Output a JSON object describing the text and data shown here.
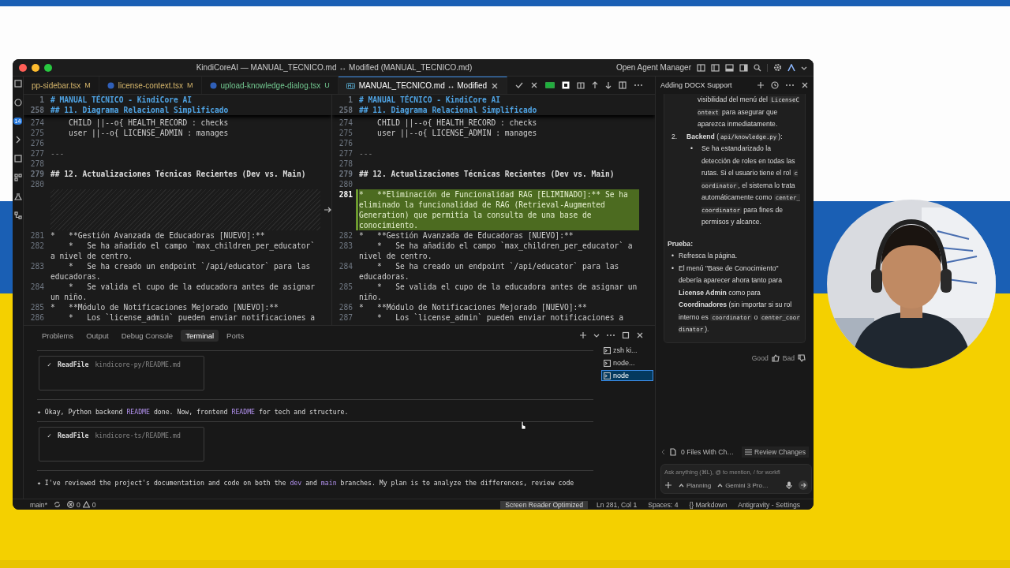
{
  "window": {
    "title": "KindiCoreAI — MANUAL_TECNICO.md ↔ Modified (MANUAL_TECNICO.md)",
    "agent_manager": "Open Agent Manager"
  },
  "activity_bar": {
    "badge": "14"
  },
  "tabs": [
    {
      "label": "pp-sidebar.tsx",
      "status": "M",
      "kind": "modified",
      "selected": false
    },
    {
      "label": "license-context.tsx",
      "status": "M",
      "kind": "modified",
      "selected": false
    },
    {
      "label": "upload-knowledge-dialog.tsx",
      "status": "U",
      "kind": "untracked",
      "selected": false
    },
    {
      "label": "MANUAL_TECNICO.md ↔ Modified",
      "kind": "diff",
      "selected": true
    }
  ],
  "editor": {
    "panes": [
      {
        "sticky": [
          {
            "number": "1",
            "text": "# MANUAL TÉCNICO - KindiCore AI",
            "kind": "title"
          },
          {
            "number": "258",
            "text": "## 11. Diagrama Relacional Simplificado",
            "kind": "title"
          }
        ],
        "lines": [
          {
            "number": "274",
            "text": "    CHILD ||--o{ HEALTH_RECORD : checks",
            "kind": "code"
          },
          {
            "number": "275",
            "text": "    user ||--o{ LICENSE_ADMIN : manages",
            "kind": "code"
          },
          {
            "number": "276",
            "kind": "code"
          },
          {
            "number": "277",
            "text": "---",
            "kind": "rule"
          },
          {
            "number": "278",
            "kind": "code"
          },
          {
            "number": "279",
            "text": "## 12. Actualizaciones Técnicas Recientes (Dev vs. Main)",
            "kind": "heading"
          },
          {
            "number": "280",
            "kind": "code"
          },
          {
            "kind": "gap"
          },
          {
            "number": "281",
            "text": "*   **Gestión Avanzada de Educadoras [NUEVO]:**",
            "kind": "code"
          },
          {
            "number": "282",
            "text": "    *   Se ha añadido el campo `max_children_per_educator` a nivel de centro.",
            "kind": "code"
          },
          {
            "number": "283",
            "text": "    *   Se ha creado un endpoint `/api/educator` para las educadoras.",
            "kind": "code"
          },
          {
            "number": "284",
            "text": "    *   Se valida el cupo de la educadora antes de asignar un niño.",
            "kind": "code"
          },
          {
            "number": "285",
            "text": "*   **Módulo de Notificaciones Mejorado [NUEVO]:**",
            "kind": "code"
          },
          {
            "number": "286",
            "text": "    *   Los `license_admin` pueden enviar notificaciones a",
            "kind": "code"
          }
        ]
      },
      {
        "sticky": [
          {
            "number": "1",
            "text": "# MANUAL TÉCNICO - KindiCore AI",
            "kind": "title"
          },
          {
            "number": "258",
            "text": "## 11. Diagrama Relacional Simplificado",
            "kind": "title"
          }
        ],
        "lines": [
          {
            "number": "274",
            "text": "    CHILD ||--o{ HEALTH_RECORD : checks",
            "kind": "code"
          },
          {
            "number": "275",
            "text": "    user ||--o{ LICENSE_ADMIN : manages",
            "kind": "code"
          },
          {
            "number": "276",
            "kind": "code"
          },
          {
            "number": "277",
            "text": "---",
            "kind": "rule"
          },
          {
            "number": "278",
            "kind": "code"
          },
          {
            "number": "279",
            "text": "## 12. Actualizaciones Técnicas Recientes (Dev vs. Main)",
            "kind": "heading"
          },
          {
            "number": "280",
            "kind": "code"
          },
          {
            "number": "281",
            "text": "*   **Eliminación de Funcionalidad RAG [ELIMINADO]:** Se ha eliminado la funcionalidad de RAG (Retrieval-Augmented Generation) que permitía la consulta de una base de conocimiento.",
            "kind": "added"
          },
          {
            "number": "282",
            "text": "*   **Gestión Avanzada de Educadoras [NUEVO]:**",
            "kind": "code"
          },
          {
            "number": "283",
            "text": "    *   Se ha añadido el campo `max_children_per_educator` a nivel de centro.",
            "kind": "code"
          },
          {
            "number": "284",
            "text": "    *   Se ha creado un endpoint `/api/educator` para las educadoras.",
            "kind": "code"
          },
          {
            "number": "285",
            "text": "    *   Se valida el cupo de la educadora antes de asignar un niño.",
            "kind": "code"
          },
          {
            "number": "286",
            "text": "*   **Módulo de Notificaciones Mejorado [NUEVO]:**",
            "kind": "code"
          },
          {
            "number": "287",
            "text": "    *   Los `license_admin` pueden enviar notificaciones a",
            "kind": "code"
          }
        ]
      }
    ]
  },
  "panel": {
    "tabs": [
      {
        "label": "Problems",
        "selected": false
      },
      {
        "label": "Output",
        "selected": false
      },
      {
        "label": "Debug Console",
        "selected": false
      },
      {
        "label": "Terminal",
        "selected": true
      },
      {
        "label": "Ports",
        "selected": false
      }
    ],
    "terminal": [
      {
        "kind": "tool",
        "check": "✓",
        "tool": "ReadFile",
        "path": "kindicore-py/README.md"
      },
      {
        "kind": "message",
        "marker": "✦",
        "parts": [
          {
            "text": "Okay, Python backend ",
            "kind": "plain"
          },
          {
            "text": "README",
            "kind": "hl"
          },
          {
            "text": " done. Now, frontend ",
            "kind": "plain"
          },
          {
            "text": "README",
            "kind": "hl"
          },
          {
            "text": " for tech and structure.",
            "kind": "plain"
          }
        ]
      },
      {
        "kind": "tool",
        "check": "✓",
        "tool": "ReadFile",
        "path": "kindicore-ts/README.md"
      },
      {
        "kind": "message",
        "marker": "✦",
        "parts": [
          {
            "text": "I've reviewed the project's documentation and code on both the ",
            "kind": "plain"
          },
          {
            "text": "dev",
            "kind": "hl"
          },
          {
            "text": " and ",
            "kind": "plain"
          },
          {
            "text": "main",
            "kind": "hl"
          },
          {
            "text": " branches. My plan is to analyze the differences, review code",
            "kind": "plain"
          }
        ]
      }
    ],
    "sessions": [
      {
        "label": "zsh ki...",
        "selected": false
      },
      {
        "label": "node...",
        "selected": false
      },
      {
        "label": "node",
        "selected": true
      }
    ]
  },
  "agent": {
    "title": "Adding DOCX Support",
    "blocks": [
      {
        "kind": "continuation",
        "parts": [
          {
            "text": "visibilidad del menú del ",
            "kind": "plain"
          },
          {
            "text": "LicenseContext",
            "kind": "code"
          },
          {
            "text": " para asegurar que aparezca inmediatamente.",
            "kind": "plain"
          }
        ]
      },
      {
        "kind": "numbered",
        "marker": "2.",
        "parts": [
          {
            "text": "Backend",
            "kind": "bold"
          },
          {
            "text": " (",
            "kind": "plain"
          },
          {
            "text": "api/knowledge.py",
            "kind": "code"
          },
          {
            "text": "):",
            "kind": "plain"
          }
        ],
        "bullets": [
          {
            "marker": "•",
            "parts": [
              {
                "text": "Se ha estandarizado la detección de roles en todas las rutas. Si el usuario tiene el rol ",
                "kind": "plain"
              },
              {
                "text": "coordinator",
                "kind": "code"
              },
              {
                "text": ", el sistema lo trata automáticamente como ",
                "kind": "plain"
              },
              {
                "text": "center_coordinator",
                "kind": "code"
              },
              {
                "text": " para fines de permisos y alcance.",
                "kind": "plain"
              }
            ]
          }
        ]
      },
      {
        "kind": "heading",
        "text": "Prueba:"
      },
      {
        "kind": "bullet",
        "marker": "•",
        "parts": [
          {
            "text": "Refresca la página.",
            "kind": "plain"
          }
        ]
      },
      {
        "kind": "bullet",
        "marker": "•",
        "parts": [
          {
            "text": "El menú \"Base de Conocimiento\" debería aparecer ahora tanto para ",
            "kind": "plain"
          },
          {
            "text": "License Admin",
            "kind": "bold"
          },
          {
            "text": " como para ",
            "kind": "plain"
          },
          {
            "text": "Coordinadores",
            "kind": "bold"
          },
          {
            "text": " (sin importar si su rol interno es ",
            "kind": "plain"
          },
          {
            "text": "coordinator",
            "kind": "code"
          },
          {
            "text": " o ",
            "kind": "plain"
          },
          {
            "text": "center_coordinator",
            "kind": "code"
          },
          {
            "text": ").",
            "kind": "plain"
          }
        ]
      }
    ],
    "feedback": [
      "Good",
      "Bad"
    ],
    "files": "0 Files With Ch…",
    "review": "Review Changes",
    "input": {
      "placeholder": "Ask anything (⌘L), @ to mention, / for workfl"
    },
    "mode": "Planning",
    "model": "Gemini 3 Pro…"
  },
  "status_bar": {
    "branch": "main*",
    "errors": "0",
    "warnings": "0",
    "items": [
      {
        "text": "Screen Reader Optimized",
        "highlighted": true
      },
      {
        "text": "Ln 281, Col 1",
        "highlighted": false
      },
      {
        "text": "Spaces: 4",
        "highlighted": false
      },
      {
        "text": "{} Markdown",
        "highlighted": false
      },
      {
        "text": "Antigravity - Settings",
        "highlighted": false
      }
    ]
  }
}
